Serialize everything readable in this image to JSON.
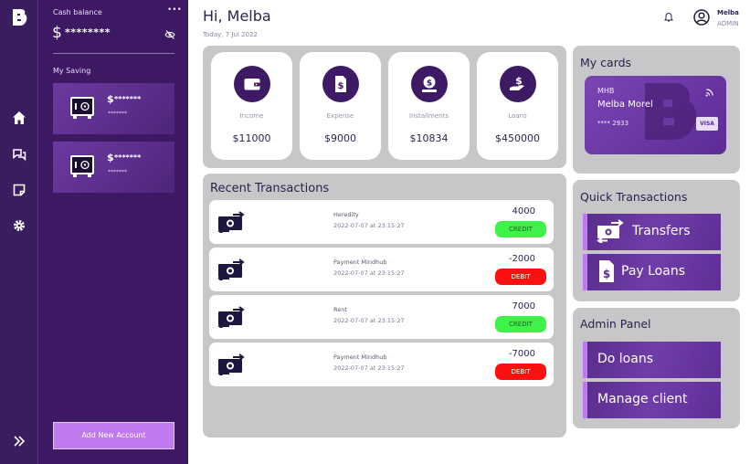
{
  "sidebar": {
    "cash_balance_label": "Cash balance",
    "menu_dots": "•••",
    "currency": "$",
    "balance_masked": "********",
    "my_saving_label": "My Saving",
    "savings": [
      {
        "currency": "$",
        "amount_masked": "*******",
        "sub_masked": "*******"
      },
      {
        "currency": "$",
        "amount_masked": "*******",
        "sub_masked": "*******"
      }
    ],
    "add_account_label": "Add New Account"
  },
  "rail": {
    "icons": [
      "logo-b-icon",
      "home-icon",
      "chat-icon",
      "note-icon",
      "settings-icon",
      "expand-icon"
    ]
  },
  "header": {
    "greeting": "Hi, Melba",
    "date": "Today, 7 Jul 2022",
    "user_name": "Melba",
    "user_role": "ADMIN"
  },
  "stats": [
    {
      "label": "Income",
      "value": "$11000",
      "icon": "wallet-icon"
    },
    {
      "label": "Expense",
      "value": "$9000",
      "icon": "receipt-icon"
    },
    {
      "label": "Installments",
      "value": "$10834",
      "icon": "coin-hand-icon"
    },
    {
      "label": "Loans",
      "value": "$450000",
      "icon": "money-hand-icon"
    }
  ],
  "recent_transactions": {
    "title": "Recent Transactions",
    "items": [
      {
        "description": "Heredity",
        "date": "2022-07-07 at 23:15:27",
        "amount": "4000",
        "type": "CREDIT"
      },
      {
        "description": "Payment Mindhub",
        "date": "2022-07-07 at 23:15:27",
        "amount": "-2000",
        "type": "DEBIT"
      },
      {
        "description": "Rent",
        "date": "2022-07-07 at 23:15:27",
        "amount": "7000",
        "type": "CREDIT"
      },
      {
        "description": "Payment Mindhub",
        "date": "2022-07-07 at 23:15:27",
        "amount": "-7000",
        "type": "DEBIT"
      }
    ]
  },
  "my_cards": {
    "title": "My cards",
    "card": {
      "bank": "MHB",
      "holder": "Melba Morel",
      "number": "**** 2933",
      "network": "VISA"
    }
  },
  "quick_transactions": {
    "title": "Quick Transactions",
    "transfers_label": "Transfers",
    "pay_loans_label": "Pay Loans"
  },
  "admin_panel": {
    "title": "Admin Panel",
    "do_loans_label": "Do loans",
    "manage_client_label": "Manage client"
  },
  "colors": {
    "sidebar": "#3d1963",
    "rail": "#3a1d5e",
    "accent": "#bf7af0",
    "credit": "#3ef24a",
    "debit": "#ff1010",
    "panel": "#c7c6c8"
  }
}
